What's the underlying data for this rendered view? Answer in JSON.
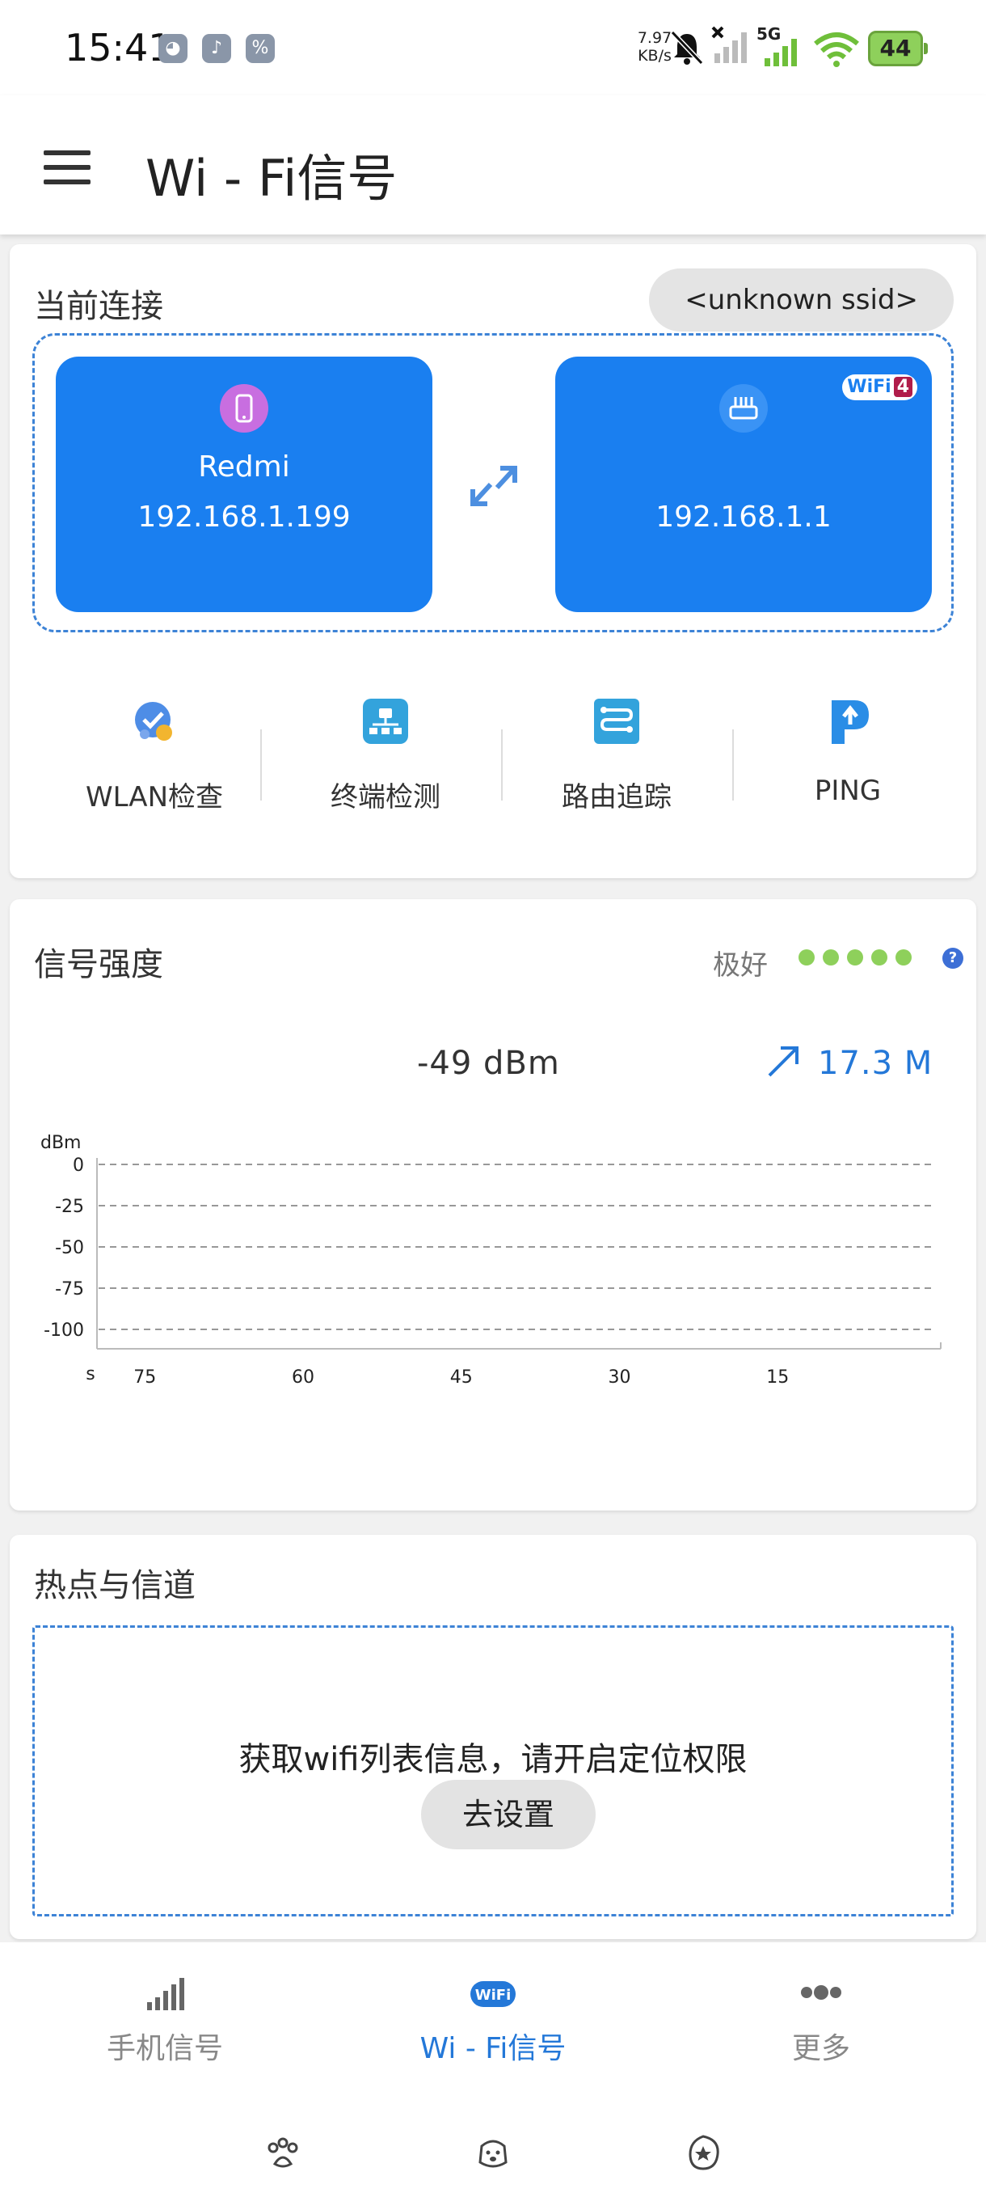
{
  "status_bar": {
    "time": "15:41",
    "net_speed_value": "7.97",
    "net_speed_unit": "KB/s",
    "network_type": "5G",
    "battery": "44"
  },
  "app_bar": {
    "title": "Wi - Fi信号"
  },
  "connection": {
    "title": "当前连接",
    "ssid": "<unknown ssid>",
    "device": {
      "name": "Redmi",
      "ip": "192.168.1.199"
    },
    "router": {
      "ip": "192.168.1.1",
      "badge_text": "WiFi",
      "badge_generation": "4"
    },
    "tools": [
      {
        "label": "WLAN检查",
        "icon": "shield-check-icon"
      },
      {
        "label": "终端检测",
        "icon": "terminal-detect-icon"
      },
      {
        "label": "路由追踪",
        "icon": "route-trace-icon"
      },
      {
        "label": "PING",
        "icon": "ping-icon"
      }
    ]
  },
  "signal": {
    "title": "信号强度",
    "quality_label": "极好",
    "quality_dots": 5,
    "dbm_text": "-49  dBm",
    "link_speed": "17.3  M",
    "colors": {
      "dots": "#8ed05b",
      "speed": "#2478d8"
    }
  },
  "chart_data": {
    "type": "line",
    "title": "",
    "ylabel": "dBm",
    "xlabel": "s",
    "ylim": [
      -100,
      0
    ],
    "yticks": [
      0,
      -25,
      -50,
      -75,
      -100
    ],
    "xticks": [
      75,
      60,
      45,
      30,
      15
    ],
    "xlim": [
      80,
      0
    ],
    "grid": true,
    "series": []
  },
  "hotspot": {
    "title": "热点与信道",
    "hint": "获取wifi列表信息，请开启定位权限",
    "button": "去设置"
  },
  "bottom_nav": {
    "items": [
      {
        "label": "手机信号",
        "icon": "signal-bars-icon"
      },
      {
        "label": "Wi - Fi信号",
        "icon": "wifi-icon"
      },
      {
        "label": "更多",
        "icon": "more-dots-icon"
      }
    ],
    "active_index": 1
  }
}
